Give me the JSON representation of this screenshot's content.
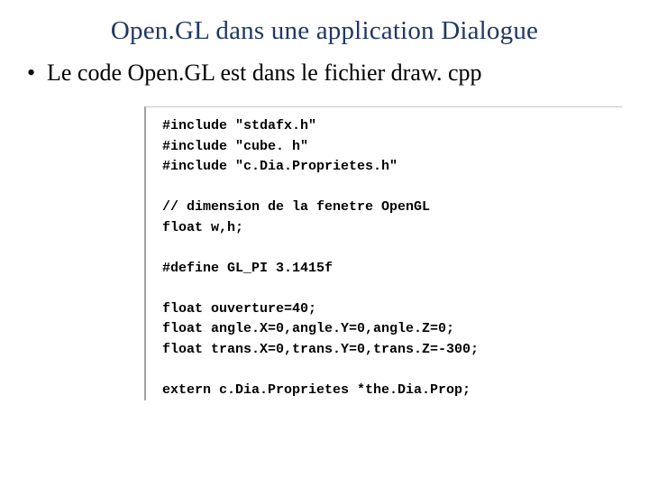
{
  "title": "Open.GL dans une application Dialogue",
  "bullet": {
    "marker": "•",
    "text": "Le code Open.GL est dans le fichier draw. cpp"
  },
  "code": {
    "lines": [
      "#include \"stdafx.h\"",
      "#include \"cube. h\"",
      "#include \"c.Dia.Proprietes.h\"",
      "",
      "// dimension de la fenetre OpenGL",
      "float w,h;",
      "",
      "#define GL_PI 3.1415f",
      "",
      "float ouverture=40;",
      "float angle.X=0,angle.Y=0,angle.Z=0;",
      "float trans.X=0,trans.Y=0,trans.Z=-300;",
      "",
      "extern c.Dia.Proprietes *the.Dia.Prop;"
    ]
  }
}
